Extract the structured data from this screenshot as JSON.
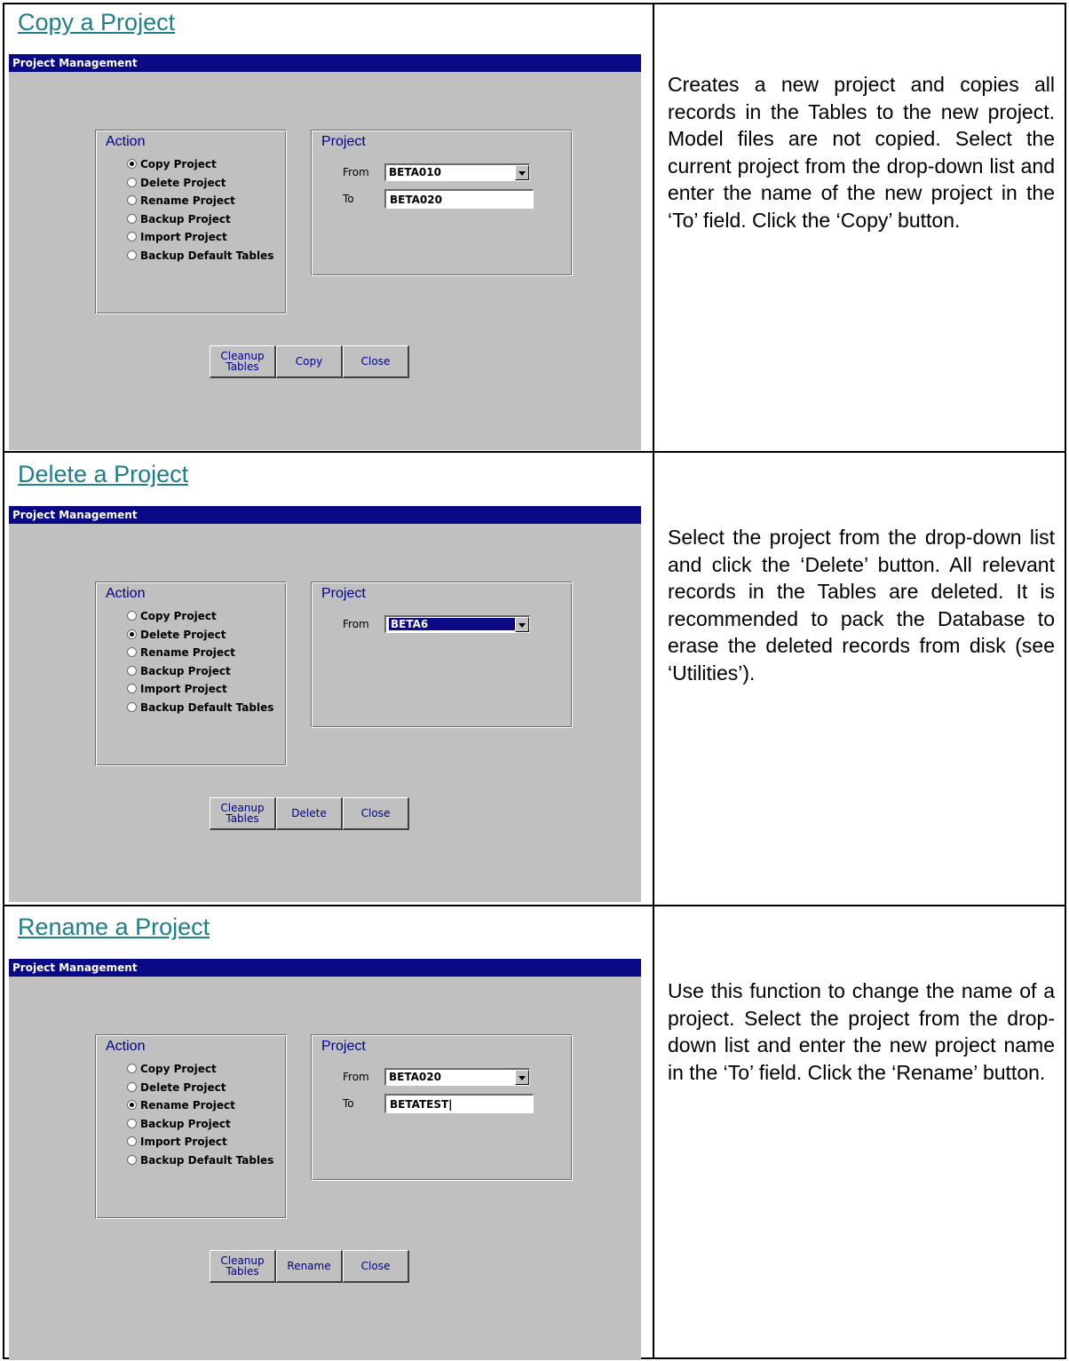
{
  "sections": [
    {
      "title": "Copy a Project",
      "window_title": "Project Management",
      "action_group_title": "Action",
      "actions": [
        "Copy Project",
        "Delete Project",
        "Rename Project",
        "Backup Project",
        "Import Project",
        "Backup Default Tables"
      ],
      "selected_action": "Copy Project",
      "project_group_title": "Project",
      "from_label": "From",
      "from_value": "BETA010",
      "to_label": "To",
      "to_value": "BETA020",
      "buttons": [
        "Cleanup\nTables",
        "Copy",
        "Close"
      ],
      "description": "Creates a new project and copies all records in the Tables to the new project. Model files are not copied. Select the current project from the drop-down list and enter the name of the new project in the ‘To’ field. Click the ‘Copy’ button."
    },
    {
      "title": "Delete a Project",
      "window_title": "Project Management",
      "action_group_title": "Action",
      "actions": [
        "Copy Project",
        "Delete Project",
        "Rename Project",
        "Backup Project",
        "Import Project",
        "Backup Default Tables"
      ],
      "selected_action": "Delete Project",
      "project_group_title": "Project",
      "from_label": "From",
      "from_value": "BETA6",
      "buttons": [
        "Cleanup\nTables",
        "Delete",
        "Close"
      ],
      "description": "Select the project from the drop-down list and click the ‘Delete’ button. All relevant records in the Tables are deleted. It is recommended to pack the Database to erase the deleted records from disk (see ‘Utilities’)."
    },
    {
      "title": "Rename a Project",
      "window_title": "Project Management",
      "action_group_title": "Action",
      "actions": [
        "Copy Project",
        "Delete Project",
        "Rename Project",
        "Backup Project",
        "Import Project",
        "Backup Default Tables"
      ],
      "selected_action": "Rename Project",
      "project_group_title": "Project",
      "from_label": "From",
      "from_value": "BETA020",
      "to_label": "To",
      "to_value": "BETATEST",
      "buttons": [
        "Cleanup\nTables",
        "Rename",
        "Close"
      ],
      "description": "Use this function to change the name of a project. Select the project from the drop-down list and enter the new project name in the ‘To’ field. Click the ‘Rename’ button."
    }
  ]
}
